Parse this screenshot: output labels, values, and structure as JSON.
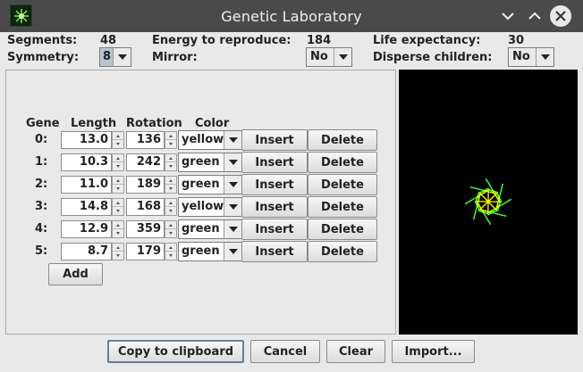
{
  "window": {
    "title": "Genetic Laboratory"
  },
  "stats": {
    "segments_label": "Segments:",
    "segments_value": "48",
    "energy_label": "Energy to reproduce:",
    "energy_value": "184",
    "life_label": "Life expectancy:",
    "life_value": "30",
    "symmetry_label": "Symmetry:",
    "symmetry_value": "8",
    "mirror_label": "Mirror:",
    "mirror_value": "No",
    "disperse_label": "Disperse children:",
    "disperse_value": "No"
  },
  "table": {
    "headers": {
      "gene": "Gene",
      "length": "Length",
      "rotation": "Rotation",
      "color": "Color"
    },
    "rows": [
      {
        "label": "0:",
        "length": "13.0",
        "rotation": "136",
        "color": "yellow"
      },
      {
        "label": "1:",
        "length": "10.3",
        "rotation": "242",
        "color": "green"
      },
      {
        "label": "2:",
        "length": "11.0",
        "rotation": "189",
        "color": "green"
      },
      {
        "label": "3:",
        "length": "14.8",
        "rotation": "168",
        "color": "yellow"
      },
      {
        "label": "4:",
        "length": "12.9",
        "rotation": "359",
        "color": "green"
      },
      {
        "label": "5:",
        "length": "8.7",
        "rotation": "179",
        "color": "green"
      }
    ],
    "insert_label": "Insert",
    "delete_label": "Delete",
    "add_label": "Add"
  },
  "footer": {
    "copy_label": "Copy to clipboard",
    "cancel_label": "Cancel",
    "clear_label": "Clear",
    "import_label": "Import..."
  },
  "colors": {
    "yellow": "#ffff00",
    "green": "#3cff3c",
    "preview_bg": "#000000",
    "titlebar": "#4a4a4a"
  }
}
